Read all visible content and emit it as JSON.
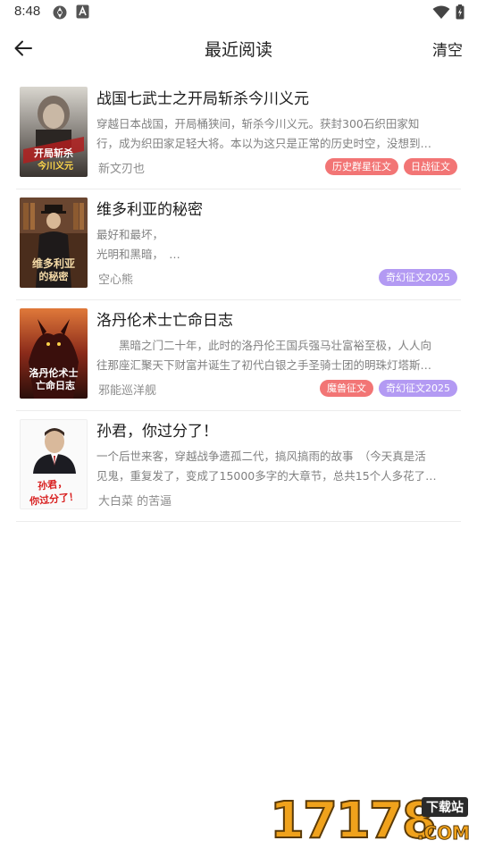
{
  "status_bar": {
    "time": "8:48",
    "icons": [
      "settings-icon",
      "a-box-icon",
      "wifi-icon",
      "battery-icon"
    ]
  },
  "header": {
    "title": "最近阅读",
    "back_icon": "arrow-left-icon",
    "clear_label": "清空"
  },
  "books": [
    {
      "title": "战国七武士之开局斩杀今川义元",
      "desc_lines": [
        "穿越日本战国，开局桶狭间，斩杀今川义元。获封300石织田家知",
        "行，成为织田家足轻大将。本以为这只是正常的历史时空，没想到…"
      ],
      "author": "新文刃也",
      "tags": [
        {
          "label": "历史群星征文",
          "color": "#f27575"
        },
        {
          "label": "日战征文",
          "color": "#f27575"
        }
      ],
      "cover_text": [
        "开局斩杀",
        "今川义元"
      ]
    },
    {
      "title": "维多利亚的秘密",
      "desc_lines": [
        "最好和最坏，",
        "光明和黑暗，　…"
      ],
      "author": "空心熊",
      "tags": [
        {
          "label": "奇幻征文2025",
          "color": "#b39af3"
        }
      ],
      "cover_text": [
        "维多利亚",
        "的秘密"
      ]
    },
    {
      "title": "洛丹伦术士亡命日志",
      "desc_lines": [
        "　　黑暗之门二十年，此时的洛丹伦王国兵强马壮富裕至极，人人向",
        "往那座汇聚天下财富并诞生了初代白银之手圣骑士团的明珠灯塔斯…"
      ],
      "author": "邪能巡洋舰",
      "tags": [
        {
          "label": "魔兽征文",
          "color": "#f27575"
        },
        {
          "label": "奇幻征文2025",
          "color": "#b39af3"
        }
      ],
      "cover_text": [
        "洛丹伦术士",
        "亡命日志"
      ]
    },
    {
      "title": "孙君，你过分了！",
      "desc_lines": [
        "一个后世来客，穿越战争遗孤二代，搞风搞雨的故事　（今天真是活",
        "见鬼，重复发了，变成了15000多字的大章节，总共15个人多花了…"
      ],
      "author": "大白菜 的苦逼",
      "tags": [],
      "cover_text": [
        "孙君，",
        "你过分了！"
      ]
    }
  ],
  "watermark": {
    "digits": "17178",
    "badge": "下载站",
    "suffix": ".COM"
  }
}
